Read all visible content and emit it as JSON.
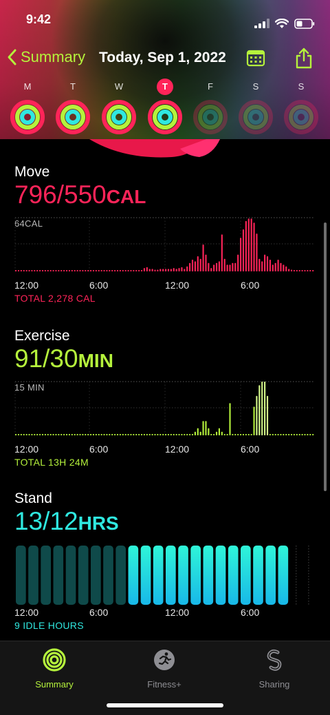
{
  "status_bar": {
    "time": "9:42"
  },
  "nav": {
    "back_label": "Summary",
    "date": "Today, Sep 1, 2022"
  },
  "week": [
    {
      "label": "M",
      "move": 1.0,
      "exercise": 1.0,
      "stand": 1.0,
      "today": false,
      "future": false
    },
    {
      "label": "T",
      "move": 1.0,
      "exercise": 1.0,
      "stand": 1.0,
      "today": false,
      "future": false
    },
    {
      "label": "W",
      "move": 1.0,
      "exercise": 1.0,
      "stand": 1.0,
      "today": false,
      "future": false
    },
    {
      "label": "T",
      "move": 1.0,
      "exercise": 1.0,
      "stand": 1.0,
      "today": true,
      "future": false
    },
    {
      "label": "F",
      "move": 0,
      "exercise": 0,
      "stand": 0,
      "today": false,
      "future": true
    },
    {
      "label": "S",
      "move": 0,
      "exercise": 0,
      "stand": 0,
      "today": false,
      "future": true
    },
    {
      "label": "S",
      "move": 0,
      "exercise": 0,
      "stand": 0,
      "today": false,
      "future": true
    }
  ],
  "colors": {
    "move": "#ff2459",
    "exercise": "#b5f23c",
    "stand": "#2fe8e0",
    "stand_idle": "#0f4a4a"
  },
  "move": {
    "title": "Move",
    "value": "796/550",
    "unit": "CAL",
    "max_label": "64CAL",
    "total": "TOTAL 2,278 CAL",
    "x_labels": [
      "12:00",
      "6:00",
      "12:00",
      "6:00"
    ]
  },
  "exercise": {
    "title": "Exercise",
    "value": "91/30",
    "unit": "MIN",
    "max_label": "15 MIN",
    "total": "TOTAL 13H 24M",
    "x_labels": [
      "12:00",
      "6:00",
      "12:00",
      "6:00"
    ]
  },
  "stand": {
    "title": "Stand",
    "value": "13/12",
    "unit": "HRS",
    "idle": "9 IDLE HOURS",
    "x_labels": [
      "12:00",
      "6:00",
      "12:00",
      "6:00"
    ]
  },
  "chart_data": [
    {
      "type": "bar",
      "title": "Move",
      "ylabel": "",
      "ymax_label": "64CAL",
      "ylim": [
        0,
        64
      ],
      "x_ticks": [
        "12:00",
        "6:00",
        "12:00",
        "6:00"
      ],
      "values": [
        1,
        1,
        1,
        1,
        1,
        1,
        1,
        1,
        1,
        1,
        1,
        1,
        1,
        1,
        1,
        1,
        1,
        1,
        1,
        1,
        1,
        1,
        1,
        1,
        1,
        1,
        1,
        1,
        1,
        1,
        1,
        1,
        1,
        1,
        1,
        1,
        1,
        1,
        1,
        1,
        1,
        1,
        1,
        1,
        1,
        1,
        1,
        1,
        4,
        5,
        3,
        3,
        2,
        2,
        3,
        3,
        3,
        3,
        3,
        4,
        3,
        4,
        5,
        3,
        6,
        10,
        14,
        12,
        18,
        15,
        32,
        20,
        10,
        4,
        8,
        10,
        12,
        44,
        15,
        8,
        8,
        10,
        10,
        20,
        40,
        50,
        60,
        63,
        63,
        58,
        45,
        15,
        12,
        20,
        18,
        14,
        8,
        10,
        14,
        10,
        8,
        6,
        3,
        2,
        1,
        1,
        1,
        1,
        1,
        1,
        1,
        1
      ]
    },
    {
      "type": "bar",
      "title": "Exercise",
      "ylabel": "",
      "ymax_label": "15 MIN",
      "ylim": [
        0,
        15
      ],
      "x_ticks": [
        "12:00",
        "6:00",
        "12:00",
        "6:00"
      ],
      "values": [
        0,
        0,
        0,
        0,
        0,
        0,
        0,
        0,
        0,
        0,
        0,
        0,
        0,
        0,
        0,
        0,
        0,
        0,
        0,
        0,
        0,
        0,
        0,
        0,
        0,
        0,
        0,
        0,
        0,
        0,
        0,
        0,
        0,
        0,
        0,
        0,
        0,
        0,
        0,
        0,
        0,
        0,
        0,
        0,
        0,
        0,
        0,
        0,
        0,
        0,
        0,
        0,
        0,
        0,
        0,
        0,
        0,
        0,
        0,
        0,
        0,
        0,
        0,
        0,
        0,
        0,
        0,
        1,
        2,
        1,
        4,
        4,
        2,
        0,
        0,
        1,
        2,
        1,
        0,
        0,
        9,
        0,
        0,
        0,
        0,
        0,
        0,
        0,
        0,
        8,
        11,
        14,
        15,
        15,
        11,
        0,
        0,
        0,
        0,
        0,
        0,
        0,
        0,
        0,
        0,
        0,
        0,
        0,
        0,
        0,
        0,
        0
      ]
    },
    {
      "type": "bar",
      "title": "Stand",
      "ylabel": "",
      "x_ticks": [
        "12:00",
        "6:00",
        "12:00",
        "6:00"
      ],
      "categories": [
        "12AM",
        "1AM",
        "2AM",
        "3AM",
        "4AM",
        "5AM",
        "6AM",
        "7AM",
        "8AM",
        "9AM",
        "10AM",
        "11AM",
        "12PM",
        "1PM",
        "2PM",
        "3PM",
        "4PM",
        "5PM",
        "6PM",
        "7PM",
        "8PM",
        "9PM",
        "10PM",
        "11PM"
      ],
      "values": [
        0,
        0,
        0,
        0,
        0,
        0,
        0,
        0,
        0,
        1,
        1,
        1,
        1,
        1,
        1,
        1,
        1,
        1,
        1,
        1,
        1,
        1,
        0,
        0
      ],
      "future": [
        false,
        false,
        false,
        false,
        false,
        false,
        false,
        false,
        false,
        false,
        false,
        false,
        false,
        false,
        false,
        false,
        false,
        false,
        false,
        false,
        false,
        false,
        true,
        true
      ]
    }
  ],
  "tabs": [
    {
      "label": "Summary",
      "active": true,
      "icon": "rings-icon"
    },
    {
      "label": "Fitness+",
      "active": false,
      "icon": "runner-icon"
    },
    {
      "label": "Sharing",
      "active": false,
      "icon": "sharing-icon"
    }
  ]
}
